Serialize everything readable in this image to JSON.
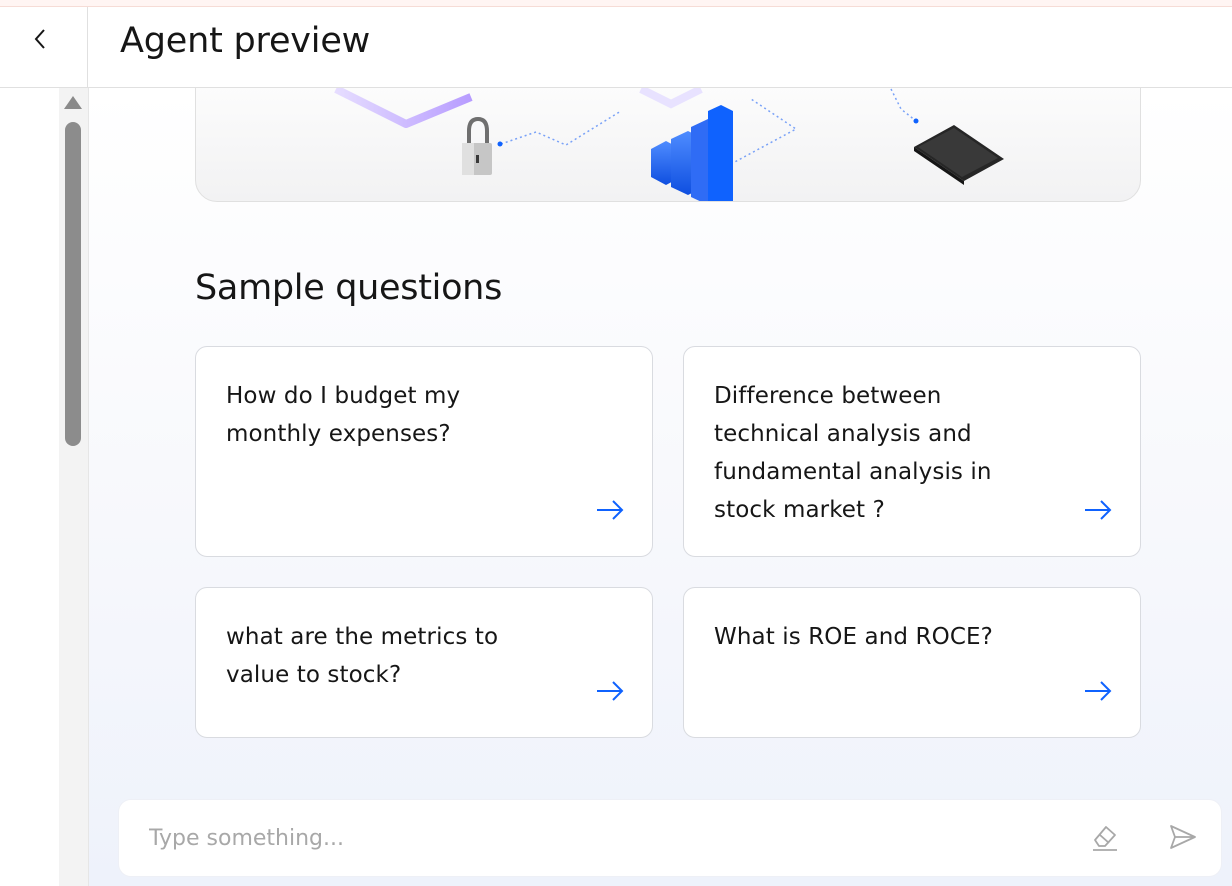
{
  "header": {
    "back_icon": "chevron-left-icon",
    "title": "Agent preview"
  },
  "main": {
    "section_title": "Sample questions",
    "sample_questions": [
      {
        "text": "How do I budget my monthly expenses?",
        "icon": "arrow-right-icon"
      },
      {
        "text": "Difference between technical analysis and fundamental analysis in stock market ?",
        "icon": "arrow-right-icon"
      },
      {
        "text": "what are the metrics to value to stock?",
        "icon": "arrow-right-icon"
      },
      {
        "text": "What is ROE and ROCE?",
        "icon": "arrow-right-icon"
      }
    ]
  },
  "composer": {
    "placeholder": "Type something...",
    "value": "",
    "erase_icon": "eraser-icon",
    "send_icon": "send-icon"
  },
  "colors": {
    "accent": "#0f62fe",
    "text": "#161616",
    "placeholder": "#a8a8a8",
    "card_border": "#d9dbe0"
  }
}
